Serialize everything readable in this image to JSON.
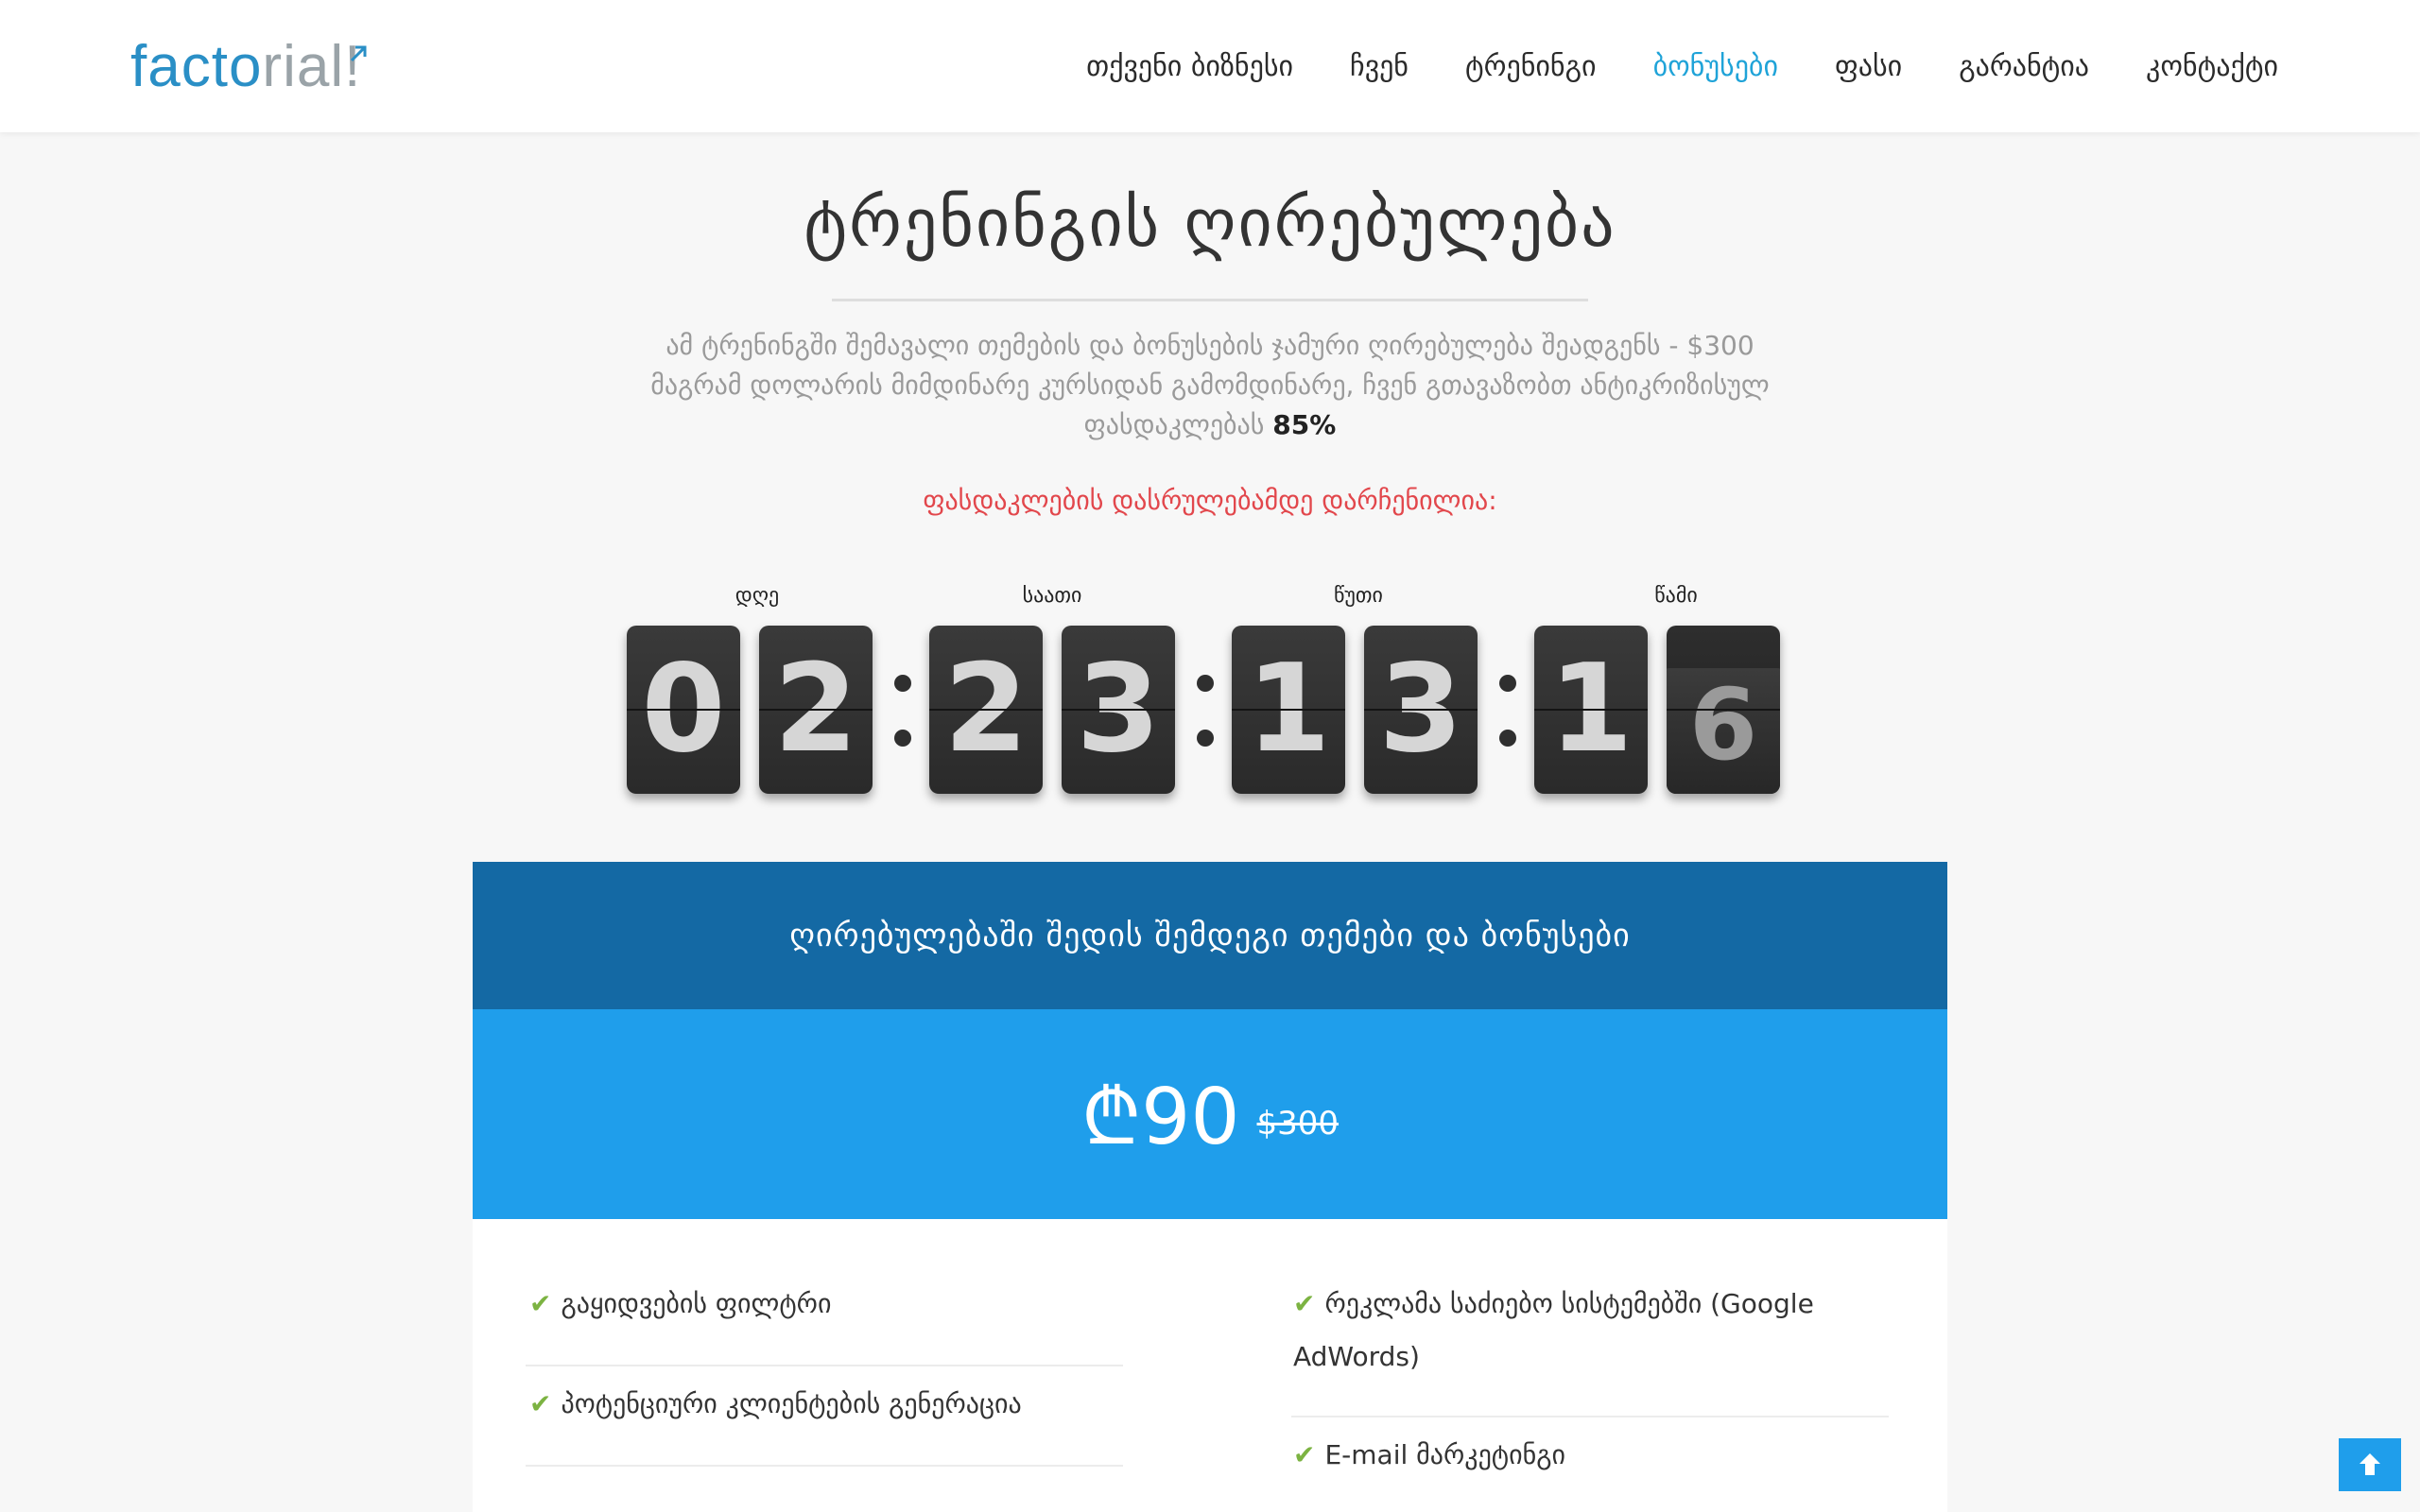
{
  "brand": {
    "logo_part1": "fact",
    "logo_mark": "o",
    "logo_part2": "rial",
    "logo_end": "!"
  },
  "nav": {
    "items": [
      {
        "label": "თქვენი ბიზნესი"
      },
      {
        "label": "ჩვენ"
      },
      {
        "label": "ტრენინგი"
      },
      {
        "label": "ბონუსები",
        "active": true
      },
      {
        "label": "ფასი"
      },
      {
        "label": "გარანტია"
      },
      {
        "label": "კონტაქტი"
      }
    ],
    "active_color": "#1fa3d8"
  },
  "hero": {
    "title": "ტრენინგის ღირებულება",
    "desc_line1": "ამ ტრენინგში შემავალი თემების და ბონუსების ჯამური ღირებულება შეადგენს - $300",
    "desc_line2": "მაგრამ დოლარის მიმდინარე კურსიდან გამომდინარე, ჩვენ გთავაზობთ ანტიკრიზისულ",
    "desc_line3": "ფასდაკლებას",
    "discount": "85%",
    "notice": "ფასდაკლების დასრულებამდე დარჩენილია:",
    "notice_color": "#e2474c"
  },
  "countdown": {
    "labels": {
      "days": "დღე",
      "hours": "საათი",
      "minutes": "წუთი",
      "seconds": "წამი"
    },
    "digits": [
      "0",
      "2",
      "2",
      "3",
      "1",
      "3",
      "1",
      "6"
    ]
  },
  "pricing": {
    "header": "ღირებულებაში შედის შემდეგი თემები და ბონუსები",
    "price_now": "₾90",
    "price_old": "$300",
    "header_color": "#1469a4",
    "price_bg_color": "#1f9eeb",
    "features_left": [
      "გაყიდვების ფილტრი",
      "პოტენციური კლიენტების გენერაცია"
    ],
    "features_right_line1": "რეკლამა საძიებო სისტემებში (Google",
    "features_right_line2": "AdWords)",
    "features_right2": "E-mail მარკეტინგი",
    "check_color": "#7cb342"
  },
  "scroll_top": {
    "icon": "arrow-up-icon"
  }
}
